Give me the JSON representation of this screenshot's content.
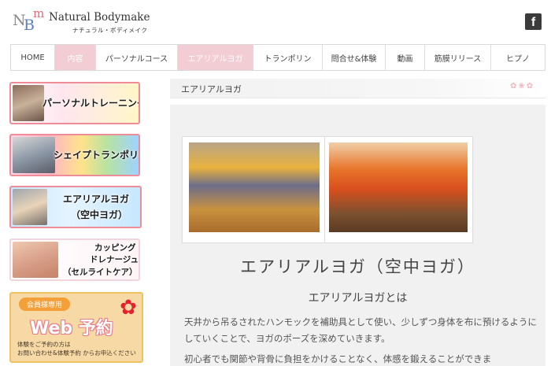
{
  "brand": {
    "mark": "NBm",
    "title": "Natural Bodymake",
    "subtitle": "ナチュラル・ボディメイク"
  },
  "social": {
    "facebook_glyph": "f"
  },
  "nav": {
    "items": [
      {
        "label": "HOME",
        "active": false
      },
      {
        "label": "内容",
        "active": true
      },
      {
        "label": "パーソナルコース",
        "active": false
      },
      {
        "label": "エアリアルヨガ",
        "active": true
      },
      {
        "label": "トランポリン",
        "active": false
      },
      {
        "label": "問合せ&体験",
        "active": false
      },
      {
        "label": "動画",
        "active": false
      },
      {
        "label": "筋膜リリース",
        "active": false
      },
      {
        "label": "ヒプノ",
        "active": false
      }
    ]
  },
  "sidebar": {
    "banners": [
      {
        "label": "パーソナルトレーニング"
      },
      {
        "label": "シェイプトランポリン"
      },
      {
        "label_line1": "エアリアルヨガ",
        "label_line2": "（空中ヨガ）"
      },
      {
        "label_line1": "カッピング",
        "label_line2": "ドレナージュ",
        "label_line3": "（セルライトケア）"
      }
    ],
    "web_reserve": {
      "badge": "会員様専用",
      "title": "Web 予約",
      "note_line1": "体験をご予約の方は",
      "note_line2": "お問い合わせ&体験予約 からお申込ください"
    }
  },
  "main": {
    "page_heading": "エアリアルヨガ",
    "section_title": "エアリアルヨガ（空中ヨガ）",
    "section_subtitle": "エアリアルヨガとは",
    "paragraph1": "天井から吊るされたハンモックを補助具として使い、少しずつ身体を布に預けるようにしていくことで、ヨガのポーズを深めていきます。",
    "paragraph2": "初心者でも関節や背骨に負担をかけることなく、体感を鍛えることができま"
  }
}
